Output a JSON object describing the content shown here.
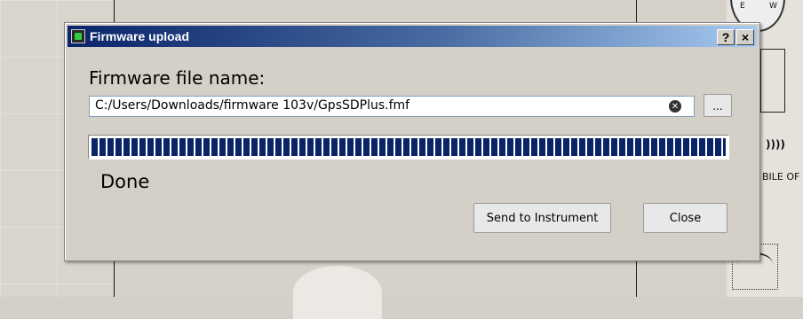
{
  "background": {
    "compass_label_e": "E",
    "compass_label_w": "W",
    "right_text": "BILE OF",
    "right_symbol": "))))"
  },
  "dialog": {
    "title": "Firmware upload",
    "help_label": "?",
    "close_label": "×",
    "file_label": "Firmware file name:",
    "file_path": "C:/Users/Downloads/firmware 103v/GpsSDPlus.fmf",
    "browse_label": "...",
    "progress_fraction": 1.0,
    "status": "Done",
    "send_button": "Send to Instrument",
    "close_button": "Close"
  },
  "icons": {
    "title_icon": "chip-icon",
    "clear_icon": "clear-circle-icon"
  }
}
